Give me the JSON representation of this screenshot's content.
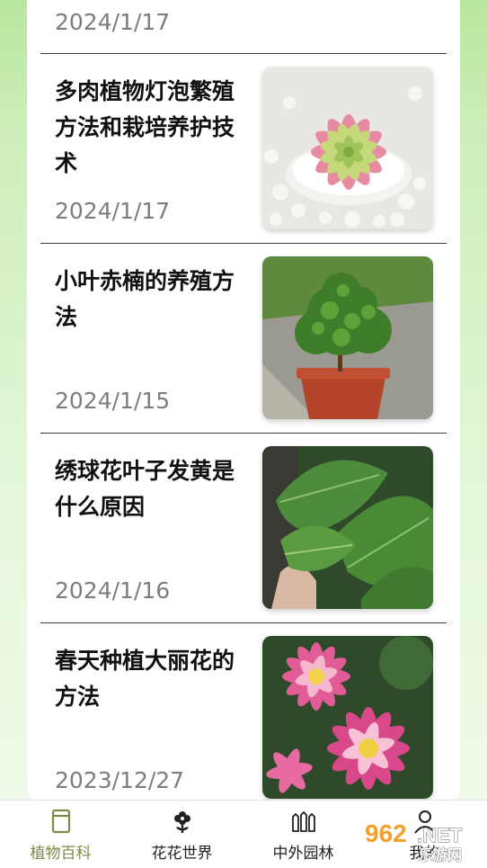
{
  "list": {
    "top_date": "2024/1/17",
    "articles": [
      {
        "title": "多肉植物灯泡繁殖方法和栽培养护技术",
        "date": "2024/1/17",
        "image": "succulent-photo"
      },
      {
        "title": "小叶赤楠的养殖方法",
        "date": "2024/1/15",
        "image": "potted-shrub-photo"
      },
      {
        "title": "绣球花叶子发黄是什么原因",
        "date": "2024/1/16",
        "image": "hydrangea-leaves-photo"
      },
      {
        "title": "春天种植大丽花的方法",
        "date": "2023/12/27",
        "image": "dahlia-flowers-photo"
      }
    ]
  },
  "tabbar": {
    "active_color": "#7d8a4a",
    "tabs": [
      {
        "label": "植物百科",
        "icon": "book-icon",
        "active": true
      },
      {
        "label": "花花世界",
        "icon": "flower-icon",
        "active": false
      },
      {
        "label": "中外园林",
        "icon": "fence-icon",
        "active": false
      },
      {
        "label": "我的",
        "icon": "user-icon",
        "active": false
      }
    ]
  },
  "watermark": {
    "brand": "962.NET",
    "subtitle": "乐游网"
  }
}
